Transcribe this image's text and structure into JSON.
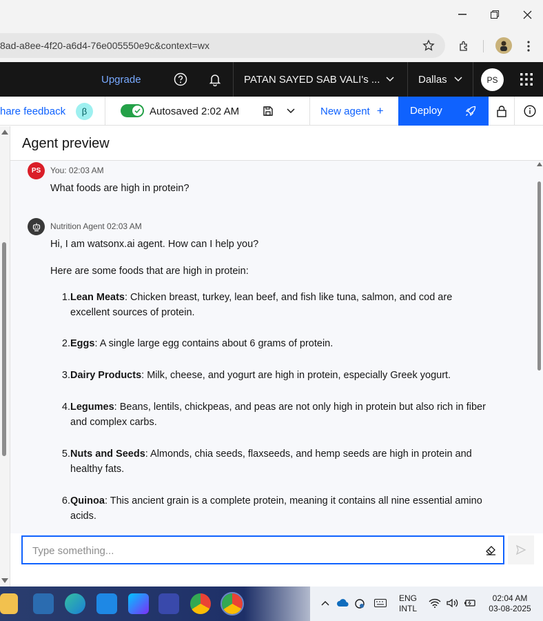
{
  "browser": {
    "url": "8ad-a8ee-4f20-a6d4-76e005550e9c&context=wx",
    "window_controls": [
      "minimize",
      "restore",
      "close"
    ]
  },
  "header": {
    "upgrade_label": "Upgrade",
    "account_label": "PATAN SAYED SAB VALI's ...",
    "region_label": "Dallas",
    "avatar_initials": "PS"
  },
  "toolbar": {
    "feedback_label": "hare feedback",
    "beta_badge": "β",
    "autosave_label": "Autosaved 2:02 AM",
    "new_agent_label": "New agent",
    "new_agent_plus": "+",
    "deploy_label": "Deploy"
  },
  "preview": {
    "title": "Agent preview"
  },
  "messages": {
    "user": {
      "avatar": "PS",
      "meta": "You: 02:03 AM",
      "text": "What foods are high in protein?"
    },
    "agent": {
      "meta": "Nutrition Agent 02:03 AM",
      "greeting": "Hi, I am watsonx.ai agent. How can I help you?",
      "intro": "Here are some foods that are high in protein:",
      "items": [
        {
          "num": "1.",
          "bold": "Lean Meats",
          "line1": ": Chicken breast, turkey, lean beef, and fish like tuna, salmon, and cod are",
          "line2": "excellent sources of protein."
        },
        {
          "num": "2.",
          "bold": "Eggs",
          "line1": ": A single large egg contains about 6 grams of protein.",
          "line2": ""
        },
        {
          "num": "3.",
          "bold": "Dairy Products",
          "line1": ": Milk, cheese, and yogurt are high in protein, especially Greek yogurt.",
          "line2": ""
        },
        {
          "num": "4.",
          "bold": "Legumes",
          "line1": ": Beans, lentils, chickpeas, and peas are not only high in protein but also rich in fiber",
          "line2": "and complex carbs."
        },
        {
          "num": "5.",
          "bold": "Nuts and Seeds",
          "line1": ": Almonds, chia seeds, flaxseeds, and hemp seeds are high in protein and",
          "line2": "healthy fats."
        },
        {
          "num": "6.",
          "bold": "Quinoa",
          "line1": ": This ancient grain is a complete protein, meaning it contains all nine essential amino",
          "line2": "acids."
        }
      ]
    }
  },
  "input": {
    "placeholder": "Type something..."
  },
  "taskbar": {
    "lang_line1": "ENG",
    "lang_line2": "INTL",
    "time": "02:04 AM",
    "date": "03-08-2025"
  },
  "colors": {
    "accent": "#0f62fe",
    "header_bg": "#161616",
    "toggle_green": "#24a148",
    "user_avatar": "#da1e28",
    "beta_badge": "#9ef0f0"
  }
}
